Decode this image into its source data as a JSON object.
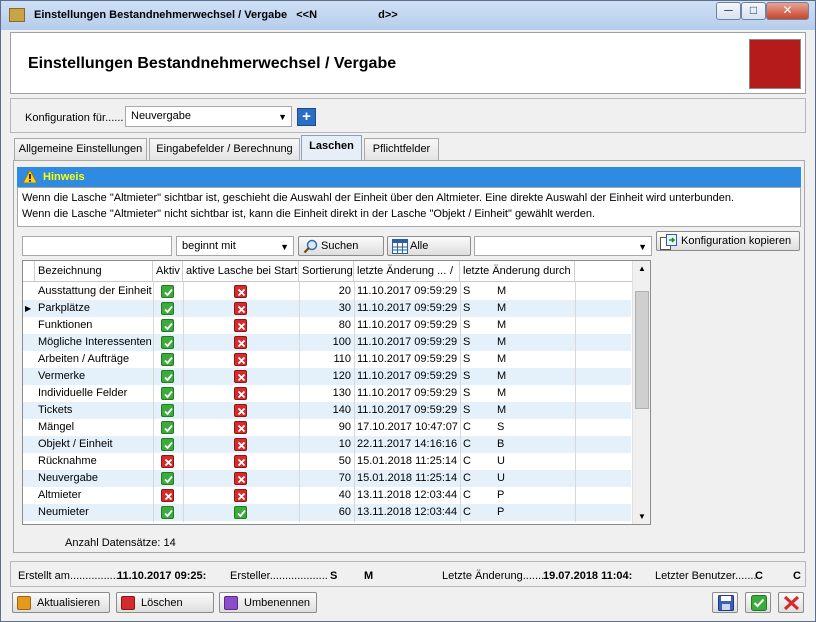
{
  "window": {
    "title": "Einstellungen Bestandnehmerwechsel / Vergabe   <<N                    d>>",
    "minimize_glyph": "─",
    "maximize_glyph": "□",
    "close_glyph": "✕"
  },
  "header": {
    "title": "Einstellungen Bestandnehmerwechsel / Vergabe",
    "accent_color": "#b51b1b"
  },
  "config": {
    "label": "Konfiguration für......",
    "selected": "Neuvergabe",
    "add_glyph": "+"
  },
  "tabs": [
    {
      "label": "Allgemeine Einstellungen",
      "active": false
    },
    {
      "label": "Eingabefelder / Berechnung",
      "active": false
    },
    {
      "label": "Laschen",
      "active": true
    },
    {
      "label": "Pflichtfelder",
      "active": false
    }
  ],
  "hinweis": {
    "label": "Hinweis",
    "line1": "Wenn die Lasche \"Altmieter\" sichtbar ist, geschieht die Auswahl der Einheit über den Altmieter. Eine direkte Auswahl der Einheit wird unterbunden.",
    "line2": "Wenn die Lasche \"Altmieter\" nicht sichtbar ist, kann die Einheit direkt in der Lasche \"Objekt / Einheit\" gewählt werden."
  },
  "filter": {
    "search_value": "",
    "mode": "beginnt mit",
    "search_button": "Suchen",
    "all_button": "Alle",
    "column_select": "",
    "copy_button": "Konfiguration kopieren"
  },
  "grid": {
    "columns": [
      "Bezeichnung",
      "Aktiv",
      "aktive Lasche bei Start",
      "Sortierung",
      "letzte Änderung ...",
      "letzte Änderung durch"
    ],
    "sort_glyph": "/",
    "current_row_glyph": "▶",
    "rows": [
      {
        "name": "Ausstattung der Einheit",
        "aktiv": true,
        "start": false,
        "sort": "20",
        "date": "11.10.2017 09:59:29",
        "by1": "S",
        "by2": "M"
      },
      {
        "name": "Parkplätze",
        "aktiv": true,
        "start": false,
        "sort": "30",
        "date": "11.10.2017 09:59:29",
        "by1": "S",
        "by2": "M"
      },
      {
        "name": "Funktionen",
        "aktiv": true,
        "start": false,
        "sort": "80",
        "date": "11.10.2017 09:59:29",
        "by1": "S",
        "by2": "M"
      },
      {
        "name": "Mögliche Interessenten",
        "aktiv": true,
        "start": false,
        "sort": "100",
        "date": "11.10.2017 09:59:29",
        "by1": "S",
        "by2": "M"
      },
      {
        "name": "Arbeiten / Aufträge",
        "aktiv": true,
        "start": false,
        "sort": "110",
        "date": "11.10.2017 09:59:29",
        "by1": "S",
        "by2": "M"
      },
      {
        "name": "Vermerke",
        "aktiv": true,
        "start": false,
        "sort": "120",
        "date": "11.10.2017 09:59:29",
        "by1": "S",
        "by2": "M"
      },
      {
        "name": "Individuelle Felder",
        "aktiv": true,
        "start": false,
        "sort": "130",
        "date": "11.10.2017 09:59:29",
        "by1": "S",
        "by2": "M"
      },
      {
        "name": "Tickets",
        "aktiv": true,
        "start": false,
        "sort": "140",
        "date": "11.10.2017 09:59:29",
        "by1": "S",
        "by2": "M"
      },
      {
        "name": "Mängel",
        "aktiv": true,
        "start": false,
        "sort": "90",
        "date": "17.10.2017 10:47:07",
        "by1": "C",
        "by2": "S"
      },
      {
        "name": "Objekt / Einheit",
        "aktiv": true,
        "start": false,
        "sort": "10",
        "date": "22.11.2017 14:16:16",
        "by1": "C",
        "by2": "B"
      },
      {
        "name": "Rücknahme",
        "aktiv": false,
        "start": false,
        "sort": "50",
        "date": "15.01.2018 11:25:14",
        "by1": "C",
        "by2": "U"
      },
      {
        "name": "Neuvergabe",
        "aktiv": true,
        "start": false,
        "sort": "70",
        "date": "15.01.2018 11:25:14",
        "by1": "C",
        "by2": "U"
      },
      {
        "name": "Altmieter",
        "aktiv": false,
        "start": false,
        "sort": "40",
        "date": "13.11.2018 12:03:44",
        "by1": "C",
        "by2": "P"
      },
      {
        "name": "Neumieter",
        "aktiv": true,
        "start": true,
        "sort": "60",
        "date": "13.11.2018 12:03:44",
        "by1": "C",
        "by2": "P"
      }
    ],
    "count_label": "Anzahl Datensätze: 14"
  },
  "status": {
    "created_label": "Erstellt am.................",
    "created_value": "11.10.2017 09:25:",
    "creator_label": "Ersteller...................",
    "creator_value1": "S",
    "creator_value2": "M",
    "changed_label": "Letzte Änderung.......",
    "changed_value": "19.07.2018 11:04:",
    "last_user_label": "Letzter Benutzer.......",
    "last_user_value1": "C",
    "last_user_value2": "C"
  },
  "buttons": {
    "refresh": "Aktualisieren",
    "delete": "Löschen",
    "rename": "Umbenennen"
  }
}
